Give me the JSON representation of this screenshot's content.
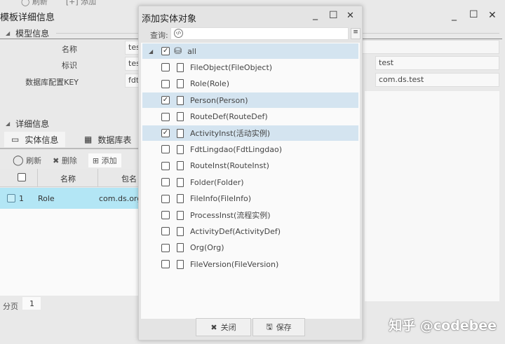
{
  "background": {
    "toolbar": {
      "refresh": "刷新",
      "add": "添加"
    },
    "window_title": "模板详细信息",
    "model_section": "模型信息",
    "form": [
      {
        "label": "名称",
        "value": "tes"
      },
      {
        "label": "标识",
        "value": "tes"
      },
      {
        "label": "数据库配置KEY",
        "value": "fdt"
      }
    ],
    "right_fields": [
      "test",
      "com.ds.test"
    ],
    "detail_section": "详细信息",
    "tabs": [
      "实体信息",
      "数据库表"
    ],
    "grid_toolbar": {
      "refresh": "刷新",
      "delete": "删除",
      "add": "添加"
    },
    "grid_headers": [
      "名称",
      "包名"
    ],
    "grid_rows": [
      {
        "index": "1",
        "name": "Role",
        "package": "com.ds.org"
      }
    ],
    "paging_label": "分页",
    "page": "1"
  },
  "dialog": {
    "title": "添加实体对象",
    "query_label": "查询:",
    "query_value": "",
    "items": [
      {
        "label": "all",
        "checked": true,
        "root": true
      },
      {
        "label": "FileObject(FileObject)",
        "checked": false
      },
      {
        "label": "Role(Role)",
        "checked": false
      },
      {
        "label": "Person(Person)",
        "checked": true
      },
      {
        "label": "RouteDef(RouteDef)",
        "checked": false
      },
      {
        "label": "ActivityInst(活动实例)",
        "checked": true
      },
      {
        "label": "FdtLingdao(FdtLingdao)",
        "checked": false
      },
      {
        "label": "RouteInst(RouteInst)",
        "checked": false
      },
      {
        "label": "Folder(Folder)",
        "checked": false
      },
      {
        "label": "FileInfo(FileInfo)",
        "checked": false
      },
      {
        "label": "ProcessInst(流程实例)",
        "checked": false
      },
      {
        "label": "ActivityDef(ActivityDef)",
        "checked": false
      },
      {
        "label": "Org(Org)",
        "checked": false
      },
      {
        "label": "FileVersion(FileVersion)",
        "checked": false
      }
    ],
    "close_label": "关闭",
    "save_label": "保存"
  },
  "watermark": "知乎 @codebee"
}
